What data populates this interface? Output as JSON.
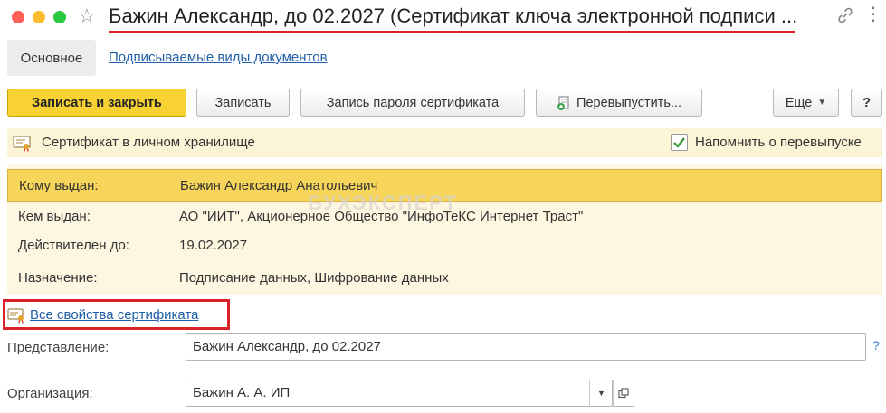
{
  "window": {
    "title": "Бажин Александр, до 02.2027 (Сертификат ключа электронной подписи ..."
  },
  "tabs": {
    "main": "Основное",
    "signed_doc_types": "Подписываемые виды документов"
  },
  "toolbar": {
    "save_close": "Записать и закрыть",
    "save": "Записать",
    "save_password": "Запись пароля сертификата",
    "reissue": "Перевыпустить...",
    "more": "Еще",
    "help": "?"
  },
  "info_strip": {
    "status": "Сертификат в личном хранилище",
    "remind_label": "Напомнить о перевыпуске",
    "remind_checked": true
  },
  "properties": [
    {
      "label": "Кому выдан:",
      "value": "Бажин Александр Анатольевич",
      "selected": true
    },
    {
      "label": "Кем выдан:",
      "value": "АО \"ИИТ\", Акционерное Общество \"ИнфоТеКС Интернет Траст\"",
      "selected": false
    },
    {
      "label": "Действителен до:",
      "value": "19.02.2027",
      "selected": false
    },
    {
      "label": "Назначение:",
      "value": "Подписание данных, Шифрование данных",
      "selected": false
    }
  ],
  "watermark": "БУХЭКСПЕРТ",
  "all_properties_link": "Все свойства сертификата",
  "form": {
    "presentation_label": "Представление:",
    "presentation_value": "Бажин Александр, до 02.2027",
    "presentation_help": "?",
    "organization_label": "Организация:",
    "organization_value": "Бажин А. А. ИП"
  },
  "colors": {
    "primary_button": "#f7d232",
    "selected_row": "#f7d55a",
    "highlight_red": "#d8232a",
    "link": "#1f5ea8"
  }
}
